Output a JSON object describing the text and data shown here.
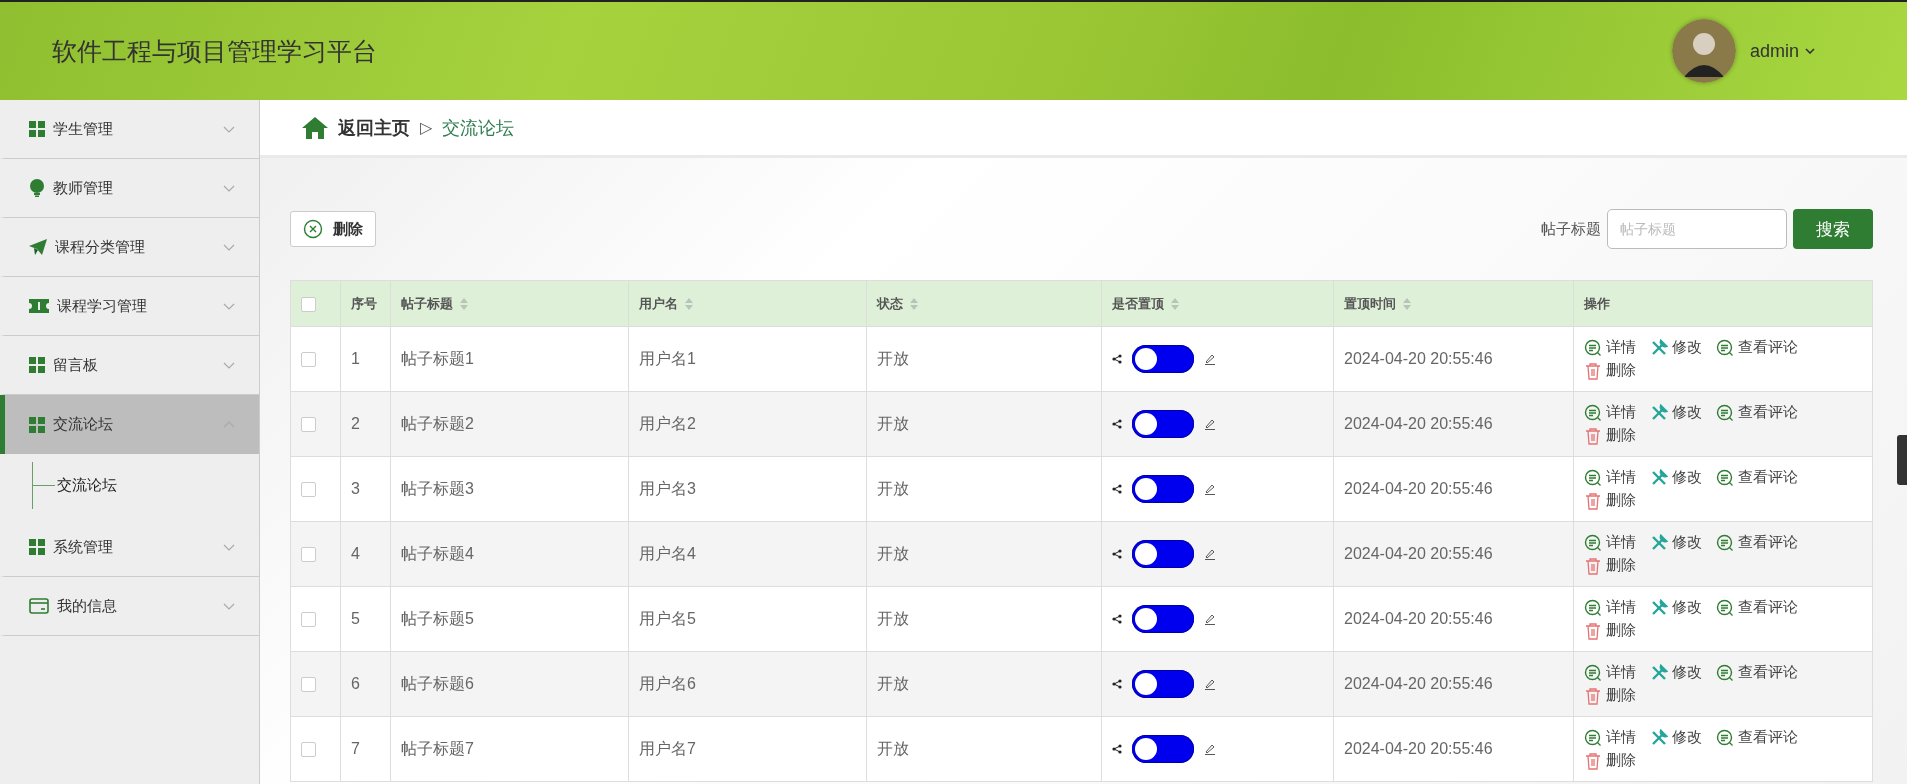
{
  "header": {
    "title": "软件工程与项目管理学习平台",
    "user": "admin"
  },
  "sidebar": {
    "items": [
      {
        "label": "学生管理",
        "selected": false,
        "expanded": false
      },
      {
        "label": "教师管理",
        "selected": false,
        "expanded": false
      },
      {
        "label": "课程分类管理",
        "selected": false,
        "expanded": false
      },
      {
        "label": "课程学习管理",
        "selected": false,
        "expanded": false
      },
      {
        "label": "留言板",
        "selected": false,
        "expanded": false
      },
      {
        "label": "交流论坛",
        "selected": true,
        "expanded": true,
        "children": [
          {
            "label": "交流论坛"
          }
        ]
      },
      {
        "label": "系统管理",
        "selected": false,
        "expanded": false
      },
      {
        "label": "我的信息",
        "selected": false,
        "expanded": false
      }
    ]
  },
  "breadcrumb": {
    "home": "返回主页",
    "separator": "▷",
    "current": "交流论坛"
  },
  "toolbar": {
    "delete": "删除",
    "search_label": "帖子标题",
    "search_placeholder": "帖子标题",
    "search_button": "搜索"
  },
  "table": {
    "all_checked": false,
    "columns": [
      {
        "label": "序号",
        "sortable": false
      },
      {
        "label": "帖子标题",
        "sortable": true
      },
      {
        "label": "用户名",
        "sortable": true
      },
      {
        "label": "状态",
        "sortable": true
      },
      {
        "label": "是否置顶",
        "sortable": true
      },
      {
        "label": "置顶时间",
        "sortable": true
      },
      {
        "label": "操作",
        "sortable": false
      }
    ],
    "rows": [
      {
        "checked": false,
        "index": "1",
        "title": "帖子标题1",
        "user": "用户名1",
        "status": "开放",
        "pinned": false,
        "time": "2024-04-20 20:55:46",
        "actions": [
          "详情",
          "修改",
          "查看评论",
          "删除"
        ]
      },
      {
        "checked": false,
        "index": "2",
        "title": "帖子标题2",
        "user": "用户名2",
        "status": "开放",
        "pinned": false,
        "time": "2024-04-20 20:55:46",
        "actions": [
          "详情",
          "修改",
          "查看评论",
          "删除"
        ]
      },
      {
        "checked": false,
        "index": "3",
        "title": "帖子标题3",
        "user": "用户名3",
        "status": "开放",
        "pinned": false,
        "time": "2024-04-20 20:55:46",
        "actions": [
          "详情",
          "修改",
          "查看评论",
          "删除"
        ]
      },
      {
        "checked": false,
        "index": "4",
        "title": "帖子标题4",
        "user": "用户名4",
        "status": "开放",
        "pinned": false,
        "time": "2024-04-20 20:55:46",
        "actions": [
          "详情",
          "修改",
          "查看评论",
          "删除"
        ]
      },
      {
        "checked": false,
        "index": "5",
        "title": "帖子标题5",
        "user": "用户名5",
        "status": "开放",
        "pinned": false,
        "time": "2024-04-20 20:55:46",
        "actions": [
          "详情",
          "修改",
          "查看评论",
          "删除"
        ]
      },
      {
        "checked": false,
        "index": "6",
        "title": "帖子标题6",
        "user": "用户名6",
        "status": "开放",
        "pinned": false,
        "time": "2024-04-20 20:55:46",
        "actions": [
          "详情",
          "修改",
          "查看评论",
          "删除"
        ]
      },
      {
        "checked": false,
        "index": "7",
        "title": "帖子标题7",
        "user": "用户名7",
        "status": "开放",
        "pinned": false,
        "time": "2024-04-20 20:55:46",
        "actions": [
          "详情",
          "修改",
          "查看评论",
          "删除"
        ]
      }
    ]
  }
}
